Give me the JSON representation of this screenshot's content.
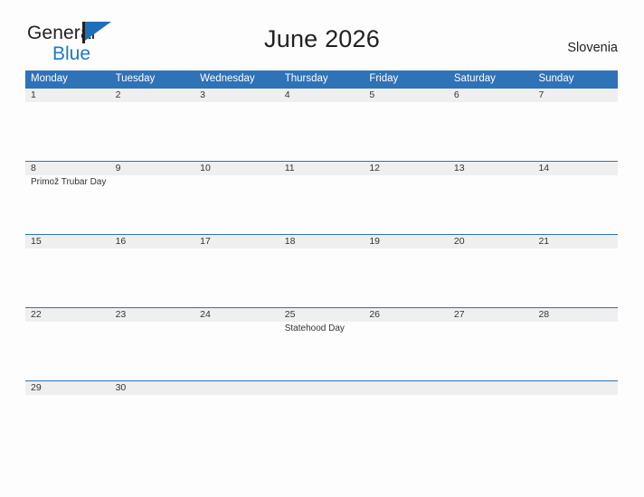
{
  "brand": {
    "name_part1": "General",
    "name_part2": "Blue",
    "flag_icon": "flag-icon",
    "accent_color": "#1d6fb8"
  },
  "header": {
    "title": "June 2026",
    "country": "Slovenia"
  },
  "theme": {
    "header_blue": "#2e72b8",
    "day_band_gray": "#efefef",
    "page_background": "#fdfdfd",
    "text_color": "#333333"
  },
  "calendar": {
    "month": "June",
    "year": "2026",
    "weekday_headers": [
      "Monday",
      "Tuesday",
      "Wednesday",
      "Thursday",
      "Friday",
      "Saturday",
      "Sunday"
    ],
    "weeks": [
      {
        "days": [
          {
            "number": "1",
            "event": ""
          },
          {
            "number": "2",
            "event": ""
          },
          {
            "number": "3",
            "event": ""
          },
          {
            "number": "4",
            "event": ""
          },
          {
            "number": "5",
            "event": ""
          },
          {
            "number": "6",
            "event": ""
          },
          {
            "number": "7",
            "event": ""
          }
        ]
      },
      {
        "days": [
          {
            "number": "8",
            "event": "Primož Trubar Day"
          },
          {
            "number": "9",
            "event": ""
          },
          {
            "number": "10",
            "event": ""
          },
          {
            "number": "11",
            "event": ""
          },
          {
            "number": "12",
            "event": ""
          },
          {
            "number": "13",
            "event": ""
          },
          {
            "number": "14",
            "event": ""
          }
        ]
      },
      {
        "days": [
          {
            "number": "15",
            "event": ""
          },
          {
            "number": "16",
            "event": ""
          },
          {
            "number": "17",
            "event": ""
          },
          {
            "number": "18",
            "event": ""
          },
          {
            "number": "19",
            "event": ""
          },
          {
            "number": "20",
            "event": ""
          },
          {
            "number": "21",
            "event": ""
          }
        ]
      },
      {
        "days": [
          {
            "number": "22",
            "event": ""
          },
          {
            "number": "23",
            "event": ""
          },
          {
            "number": "24",
            "event": ""
          },
          {
            "number": "25",
            "event": "Statehood Day"
          },
          {
            "number": "26",
            "event": ""
          },
          {
            "number": "27",
            "event": ""
          },
          {
            "number": "28",
            "event": ""
          }
        ]
      },
      {
        "days": [
          {
            "number": "29",
            "event": ""
          },
          {
            "number": "30",
            "event": ""
          },
          {
            "number": "",
            "event": ""
          },
          {
            "number": "",
            "event": ""
          },
          {
            "number": "",
            "event": ""
          },
          {
            "number": "",
            "event": ""
          },
          {
            "number": "",
            "event": ""
          }
        ]
      }
    ]
  }
}
